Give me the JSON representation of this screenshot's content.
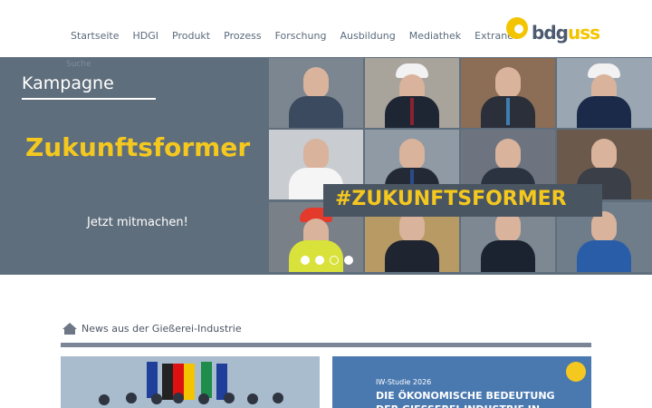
{
  "nav": {
    "items": [
      "Startseite",
      "HDGI",
      "Produkt",
      "Prozess",
      "Forschung",
      "Ausbildung",
      "Mediathek",
      "Extranet"
    ],
    "ghost_label": "Suche"
  },
  "logo": {
    "text_b": "bdg",
    "text_g": "uss"
  },
  "hero": {
    "kicker": "Kampagne",
    "title": "Zukunftsformer",
    "cta": "Jetzt mitmachen!",
    "banner": "#ZUKUNFTSFORMER",
    "slides": 4,
    "active_slide": 3
  },
  "news": {
    "heading": "News aus der Gießerei-Industrie",
    "card2_tag": "IW-Studie 2026",
    "card2_title": "DIE ÖKONOMISCHE BEDEUTUNG DER GIESSEREI-INDUSTRIE IN"
  },
  "colors": {
    "accent": "#f4c81e",
    "hero_bg": "#5f6e7c",
    "nav_text": "#5b6b7d"
  }
}
